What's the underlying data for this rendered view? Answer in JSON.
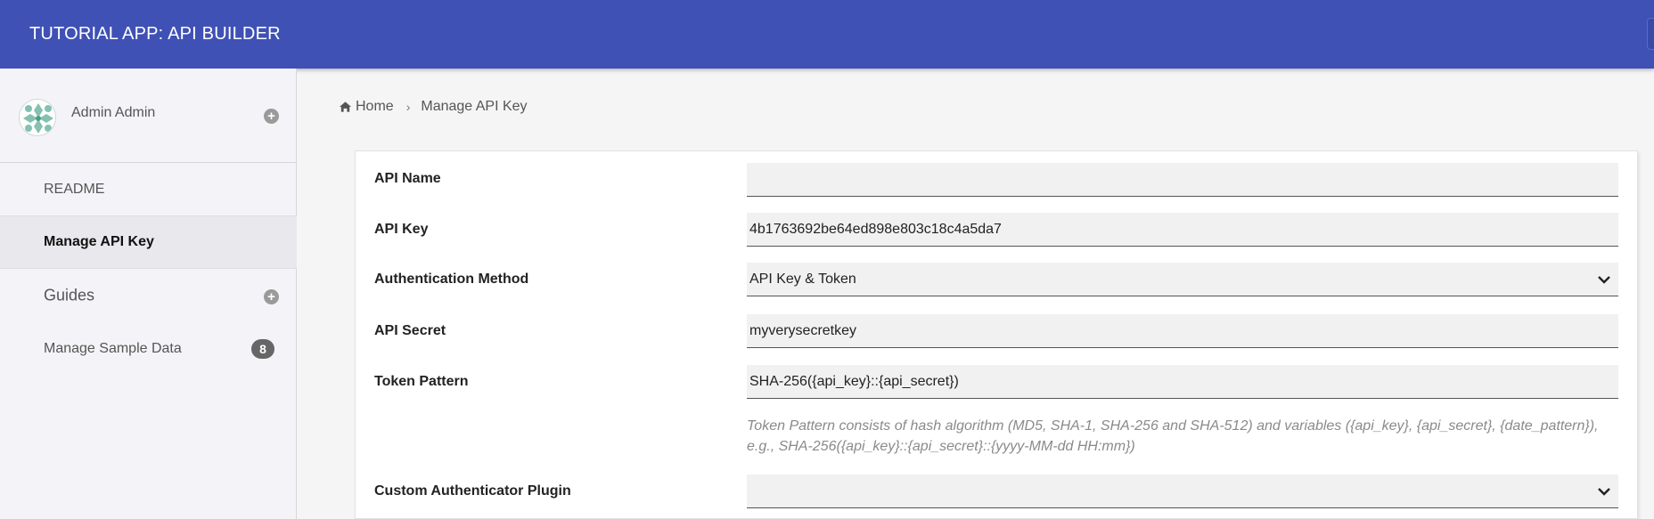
{
  "header": {
    "title": "TUTORIAL APP: API BUILDER"
  },
  "sidebar": {
    "profile": {
      "name": "Admin Admin",
      "expand_icon": "plus-circle-icon"
    },
    "items": [
      {
        "label": "README"
      },
      {
        "label": "Manage API Key",
        "active": true
      },
      {
        "label": "Guides",
        "expand_icon": "plus-circle-icon"
      },
      {
        "label": "Manage Sample Data",
        "badge": "8"
      }
    ]
  },
  "breadcrumb": {
    "home": "Home",
    "current": "Manage API Key",
    "home_icon": "home-icon",
    "separator_icon": "chevron-right-icon"
  },
  "form": {
    "api_name": {
      "label": "API Name",
      "value": ""
    },
    "api_key": {
      "label": "API Key",
      "value": "4b1763692be64ed898e803c18c4a5da7"
    },
    "auth_method": {
      "label": "Authentication Method",
      "value": "API Key & Token"
    },
    "api_secret": {
      "label": "API Secret",
      "value": "myverysecretkey"
    },
    "token_pattern": {
      "label": "Token Pattern",
      "value": "SHA-256({api_key}::{api_secret})",
      "help_line1": "Token Pattern consists of hash algorithm (MD5, SHA-1, SHA-256 and SHA-512) and variables ({api_key}, {api_secret}, {date_pattern}),",
      "help_line2": "e.g., SHA-256({api_key}::{api_secret}::{yyyy-MM-dd HH:mm})"
    },
    "custom_plugin": {
      "label": "Custom Authenticator Plugin",
      "value": ""
    }
  },
  "colors": {
    "header_bg": "#3f51b5",
    "sidebar_bg": "#f4f4f8",
    "badge_bg": "#666666"
  }
}
